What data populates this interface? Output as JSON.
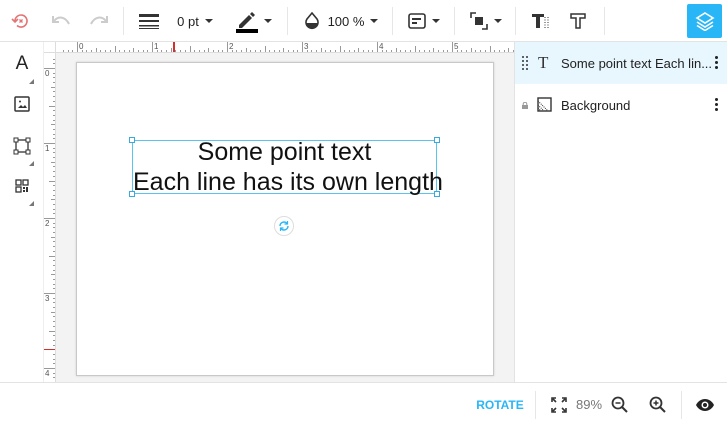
{
  "toolbar": {
    "stroke_width": "0 pt",
    "opacity": "100 %",
    "accent_color": "#29b6f6",
    "stroke_color": "#000000"
  },
  "rulers": {
    "horizontal_labels": [
      "0",
      "1",
      "2",
      "3",
      "4",
      "5"
    ],
    "vertical_labels": [
      "0",
      "1",
      "2",
      "3",
      "4"
    ]
  },
  "canvas": {
    "text_lines": [
      "Some point text",
      "Each line has its own length"
    ]
  },
  "layers": [
    {
      "name": "Some point text Each lin...",
      "icon": "text-icon",
      "selected": true
    },
    {
      "name": "Background",
      "icon": "background-icon",
      "locked": true
    }
  ],
  "bottombar": {
    "rotate_label": "ROTATE",
    "zoom": "89%"
  }
}
